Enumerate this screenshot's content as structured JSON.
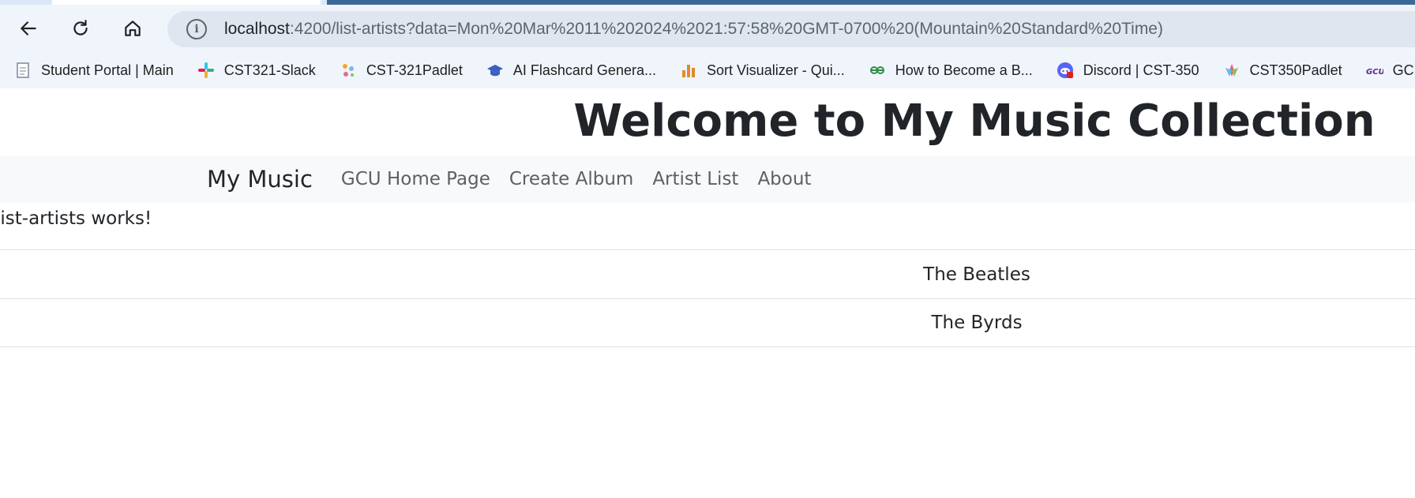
{
  "browser": {
    "url_host": "localhost",
    "url_rest": ":4200/list-artists?data=Mon%20Mar%2011%202024%2021:57:58%20GMT-0700%20(Mountain%20Standard%20Time)",
    "bookmarks": [
      {
        "label": "Student Portal | Main",
        "icon": "document-icon"
      },
      {
        "label": "CST321-Slack",
        "icon": "slack-icon"
      },
      {
        "label": "CST-321Padlet",
        "icon": "padlet-icon"
      },
      {
        "label": "AI Flashcard Genera...",
        "icon": "graduation-cap-icon"
      },
      {
        "label": "Sort Visualizer - Qui...",
        "icon": "bar-chart-icon"
      },
      {
        "label": "How to Become a B...",
        "icon": "geeksforgeeks-icon"
      },
      {
        "label": "Discord | CST-350",
        "icon": "discord-icon"
      },
      {
        "label": "CST350Padlet",
        "icon": "padlet-icon"
      },
      {
        "label": "GCU Commer",
        "icon": "gcu-icon"
      }
    ],
    "info_glyph": "i"
  },
  "page": {
    "title": "Welcome to My Music Collection",
    "navbar": {
      "brand": "My Music",
      "links": [
        "GCU Home Page",
        "Create Album",
        "Artist List",
        "About"
      ]
    },
    "works_text": "list-artists works!",
    "artists": [
      "The Beatles",
      "The Byrds"
    ]
  },
  "colors": {
    "chrome_bg": "#f0f5fc",
    "omnibox_bg": "#dfe6ef",
    "navbar_bg": "#f8f9fa",
    "text": "#212529",
    "nav_link": "#5c6066",
    "border": "#dee2e6"
  }
}
